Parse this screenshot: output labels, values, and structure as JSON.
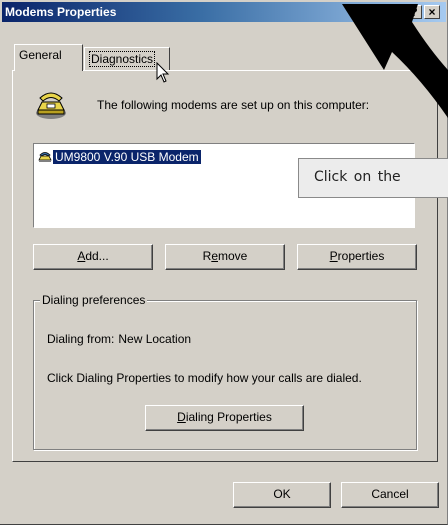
{
  "window": {
    "title": "Modems Properties",
    "help_button": "?",
    "close_button": "×"
  },
  "tabs": [
    {
      "label": "General",
      "active": true
    },
    {
      "label": "Diagnostics",
      "active": false
    }
  ],
  "intro_text": "The following modems are set up on this computer:",
  "modems": [
    {
      "name": "UM9800 V.90 USB Modem",
      "selected": true
    }
  ],
  "buttons": {
    "add_u": "A",
    "add_rest": "dd...",
    "remove_pre": "R",
    "remove_u": "e",
    "remove_rest": "move",
    "properties_u": "P",
    "properties_rest": "roperties",
    "ok": "OK",
    "cancel": "Cancel"
  },
  "dialing": {
    "legend": "Dialing preferences",
    "from_label": "Dialing from:",
    "from_value": "New Location",
    "help_text": "Click Dialing Properties to modify how your calls are dialed.",
    "button_u": "D",
    "button_rest": "ialing Properties"
  },
  "callout": {
    "text": "Click on the"
  },
  "colors": {
    "dialog_face": "#d4d0c8",
    "title_start": "#0a246a",
    "title_end": "#a6caf0",
    "selection": "#0a246a",
    "arrow": "#000000"
  },
  "icons": [
    "modem-phone-icon",
    "modem-small-icon",
    "help-icon",
    "close-icon",
    "mouse-pointer-icon",
    "annotation-arrow-icon"
  ]
}
